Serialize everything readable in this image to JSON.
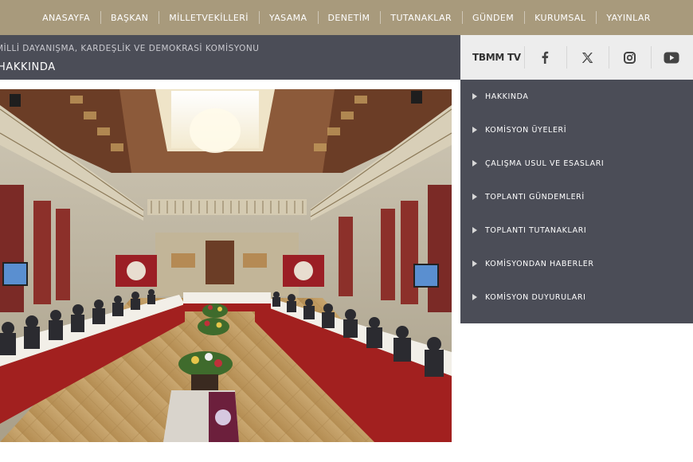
{
  "nav": {
    "items": [
      "ANASAYFA",
      "BAŞKAN",
      "MİLLETVEKİLLERİ",
      "YASAMA",
      "DENETİM",
      "TUTANAKLAR",
      "GÜNDEM",
      "KURUMSAL",
      "YAYINLAR"
    ]
  },
  "header": {
    "subtitle": "MİLLİ DAYANIŞMA, KARDEŞLİK VE DEMOKRASİ KOMİSYONU",
    "title": "HAKKINDA"
  },
  "social": {
    "tv_label": "TBMM TV",
    "icons": [
      "facebook-icon",
      "x-icon",
      "instagram-icon",
      "youtube-icon"
    ]
  },
  "sidemenu": {
    "items": [
      "HAKKINDA",
      "KOMİSYON ÜYELERİ",
      "ÇALIŞMA USUL VE ESASLARI",
      "TOPLANTI GÜNDEMLERİ",
      "TOPLANTI TUTANAKLARI",
      "KOMİSYONDAN HABERLER",
      "KOMİSYON DUYURULARI"
    ]
  },
  "colors": {
    "nav_bg": "#a89a7c",
    "panel_bg": "#4b4d57",
    "social_bg": "#ededed"
  }
}
